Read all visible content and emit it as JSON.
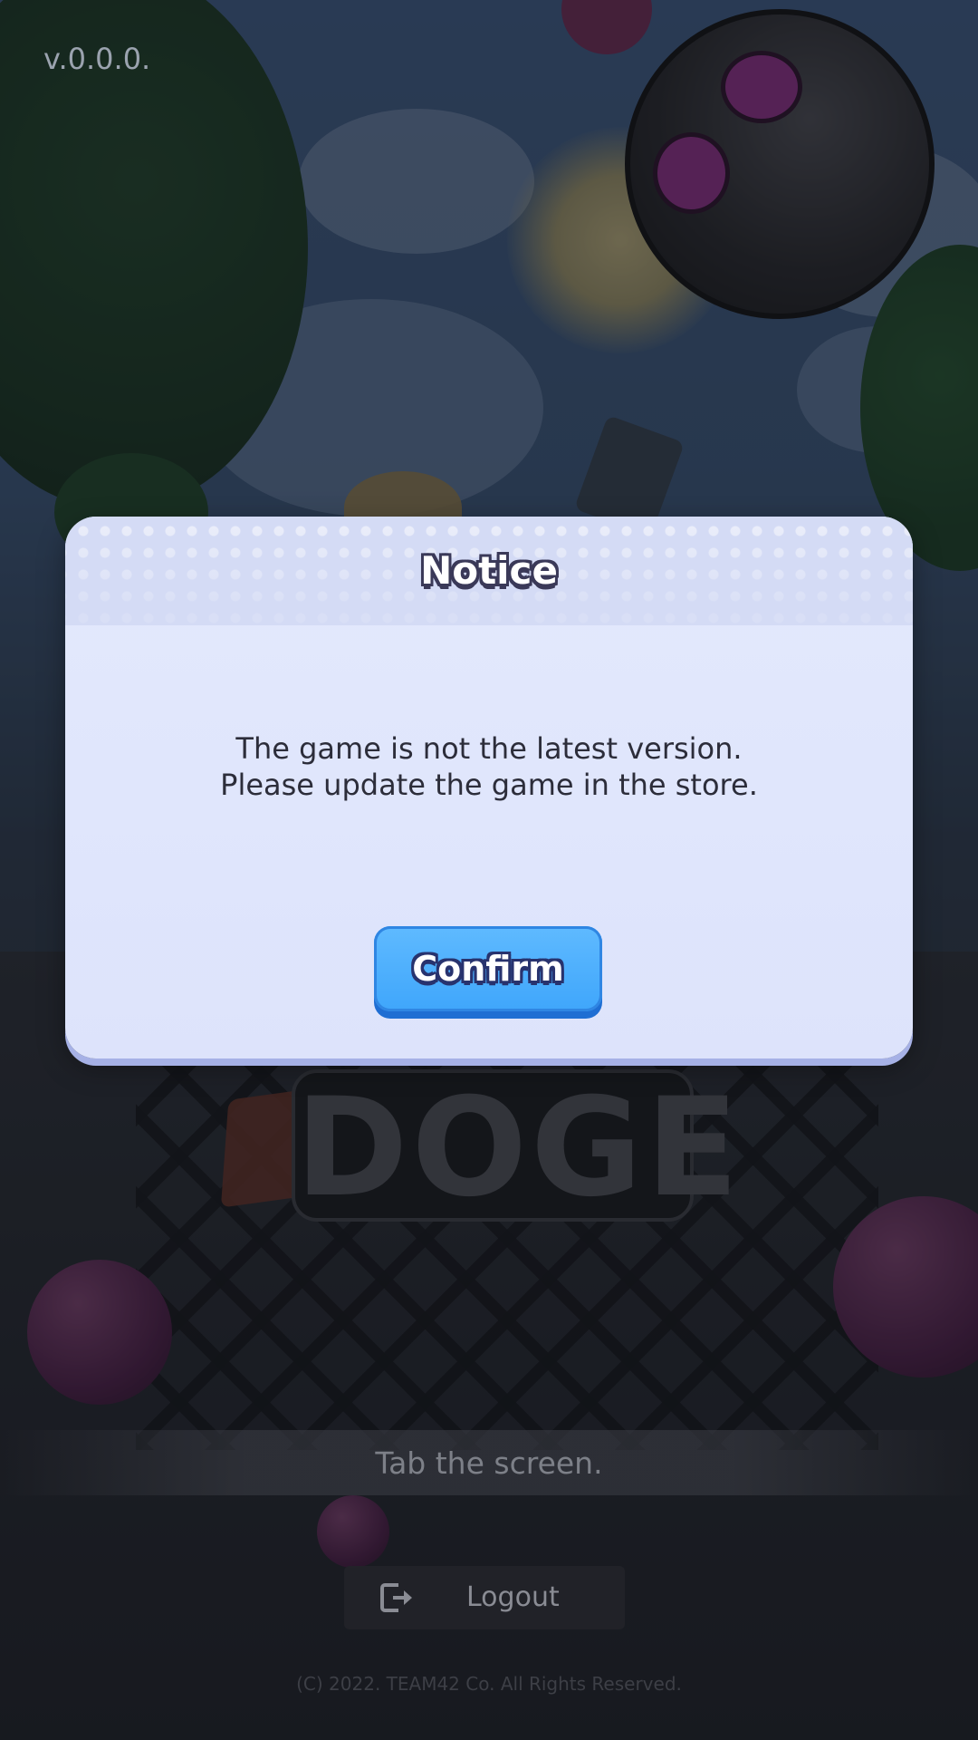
{
  "app": {
    "version": "v.0.0.0.",
    "logo_text": "DOGE"
  },
  "modal": {
    "title": "Notice",
    "message_lines": [
      "The game is not the latest version.",
      "Please update the game in the store."
    ],
    "confirm_label": "Confirm"
  },
  "footer": {
    "tap_hint": "Tab the screen.",
    "logout_label": "Logout",
    "logout_icon": "logout-icon",
    "copyright": "(C) 2022. TEAM42 Co. All Rights Reserved."
  },
  "colors": {
    "modal_bg": "#e3e9fd",
    "confirm_button": "#3fa6fb",
    "title_outline": "#3a3958"
  }
}
